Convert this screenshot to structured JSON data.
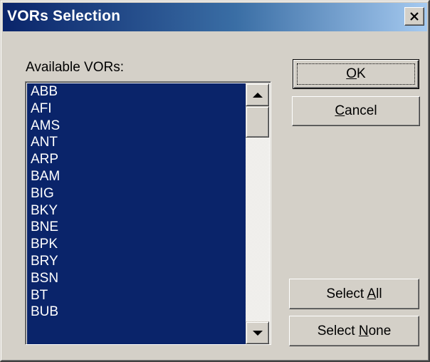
{
  "window": {
    "title": "VORs Selection",
    "close_icon": "close-icon"
  },
  "list": {
    "label": "Available VORs:",
    "items": [
      "ABB",
      "AFI",
      "AMS",
      "ANT",
      "ARP",
      "BAM",
      "BIG",
      "BKY",
      "BNE",
      "BPK",
      "BRY",
      "BSN",
      "BT",
      "BUB"
    ],
    "selection_color": "#0a246a"
  },
  "buttons": {
    "ok": {
      "label": "OK",
      "mnemonic_prefix": "",
      "mnemonic": "O",
      "rest": "K"
    },
    "cancel": {
      "label": "Cancel",
      "mnemonic_prefix": "",
      "mnemonic": "C",
      "rest": "ancel"
    },
    "select_all": {
      "label": "Select All",
      "mnemonic_prefix": "Select ",
      "mnemonic": "A",
      "rest": "ll"
    },
    "select_none": {
      "label": "Select None",
      "mnemonic_prefix": "Select ",
      "mnemonic": "N",
      "rest": "one"
    }
  },
  "colors": {
    "title_gradient_start": "#0a246a",
    "title_gradient_end": "#a6caf0",
    "face": "#d4d0c8"
  }
}
